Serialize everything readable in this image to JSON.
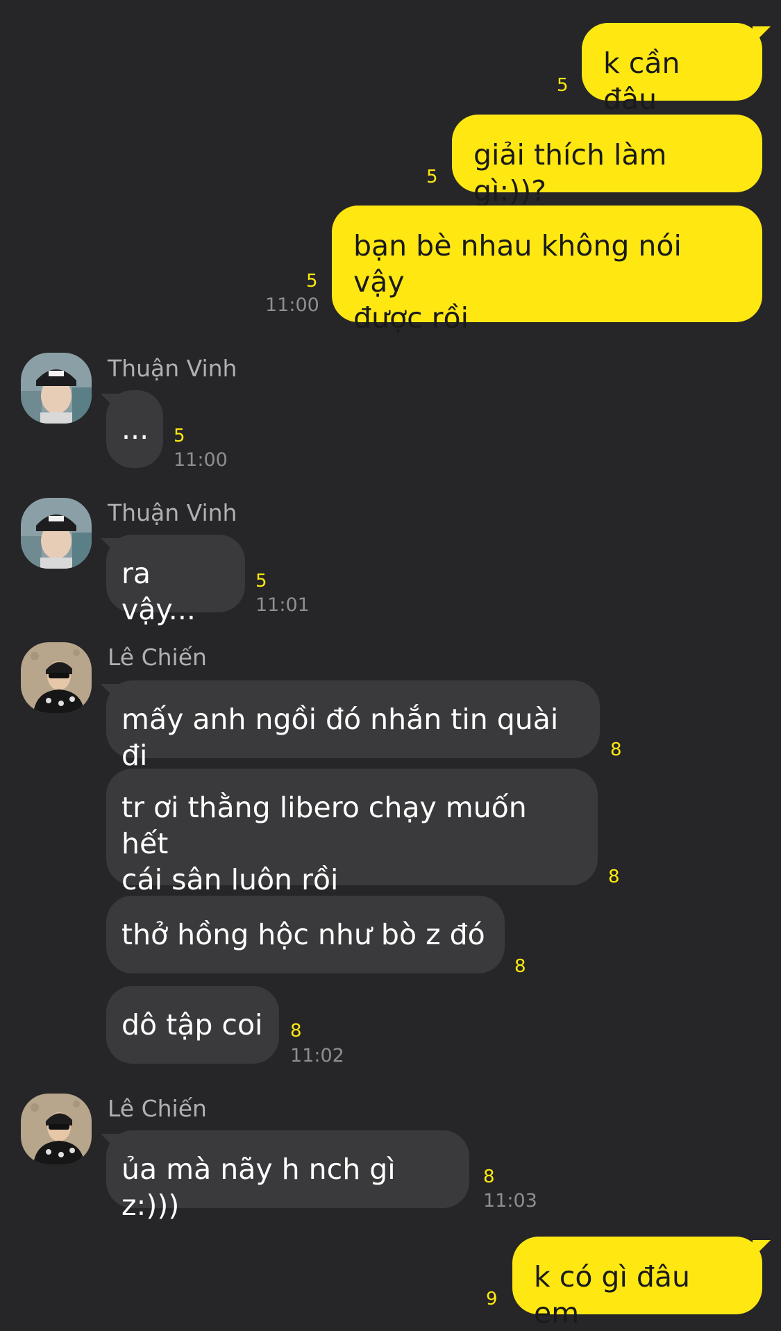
{
  "colors": {
    "background": "#262628",
    "outgoing_bubble": "#FFE812",
    "incoming_bubble": "#3a3a3c",
    "unread_count": "#FFE812",
    "timestamp": "#8e8e93",
    "sender_name": "#b0b0b4"
  },
  "messages": {
    "m1": {
      "text": "k cần đâu",
      "unread": "5"
    },
    "m2": {
      "text": "giải thích làm gì:))?",
      "unread": "5"
    },
    "m3": {
      "text": "bạn bè nhau không nói vậy\nđược rồi",
      "unread": "5",
      "time": "11:00"
    },
    "g1": {
      "sender": "Thuận Vinh",
      "avatar": "person-cap-avatar"
    },
    "m4": {
      "text": "...",
      "unread": "5",
      "time": "11:00"
    },
    "g2": {
      "sender": "Thuận Vinh",
      "avatar": "person-cap-avatar"
    },
    "m5": {
      "text": "ra vậy...",
      "unread": "5",
      "time": "11:01"
    },
    "g3": {
      "sender": "Lê Chiến",
      "avatar": "person-sunglasses-avatar"
    },
    "m6": {
      "text": "mấy anh ngồi đó nhắn tin quài đi",
      "unread": "8"
    },
    "m7": {
      "text": "tr ơi thằng libero chạy muốn hết\ncái sân luôn rồi",
      "unread": "8"
    },
    "m8": {
      "text": "thở hồng hộc như bò z đó",
      "unread": "8"
    },
    "m9": {
      "text": "dô tập coi",
      "unread": "8",
      "time": "11:02"
    },
    "g4": {
      "sender": "Lê Chiến",
      "avatar": "person-sunglasses-avatar"
    },
    "m10": {
      "text": "ủa mà nãy h nch gì z:)))",
      "unread": "8",
      "time": "11:03"
    },
    "m11": {
      "text": "k có gì đâu em",
      "unread": "9"
    }
  }
}
